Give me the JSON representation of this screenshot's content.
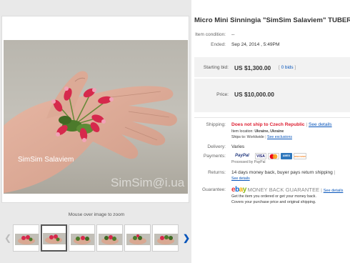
{
  "gallery": {
    "watermark_name": "SimSim Salaviem",
    "watermark_site": "SimSim@i.ua",
    "zoom_hint": "Mouse over image to zoom",
    "prev_icon": "chevron-left-icon",
    "next_icon": "chevron-right-icon",
    "thumbnail_count": 6,
    "active_thumbnail": 2
  },
  "listing": {
    "title": "Micro Mini Sinningia \"SimSim Salaviem\" TUBER,",
    "condition_label": "Item condition:",
    "condition_value": "--",
    "ended_label": "Ended:",
    "ended_value": "Sep 24, 2014 , 5:49PM",
    "starting_bid_label": "Starting bid:",
    "starting_bid_value": "US $1,300.00",
    "bids_sep_left": "[",
    "bids_value": "0 bids",
    "bids_sep_right": "]",
    "price_label": "Price:",
    "price_value": "US $10,000.00"
  },
  "shipping": {
    "label": "Shipping:",
    "value": "Does not ship to Czech Republic",
    "separator": "|",
    "details_link": "See details",
    "location_label": "Item location:",
    "location_value": "Ukraine, Ukraine",
    "ships_to_label": "Ships to:",
    "ships_to_value": "Worldwide",
    "exclusions_link": "See exclusions"
  },
  "delivery": {
    "label": "Delivery:",
    "value": "Varies"
  },
  "payments": {
    "label": "Payments:",
    "paypal": "PayPal",
    "visa": "VISA",
    "amex": "AMEX",
    "discover": "DISCOVER",
    "processed_by": "Processed by PayPal"
  },
  "returns": {
    "label": "Returns:",
    "value": "14 days money back, buyer pays return shipping",
    "separator": "|",
    "details_link": "See details"
  },
  "guarantee": {
    "label": "Guarantee:",
    "brand": "ebay",
    "program": "MONEY BACK GUARANTEE",
    "separator": "|",
    "details_link": "See details",
    "line1": "Get the item you ordered or get your money back.",
    "line2": "Covers your purchase price and original shipping."
  },
  "colors": {
    "link": "#0654ba",
    "warning": "#dd1e31",
    "price_box": "#f2f2f2"
  }
}
